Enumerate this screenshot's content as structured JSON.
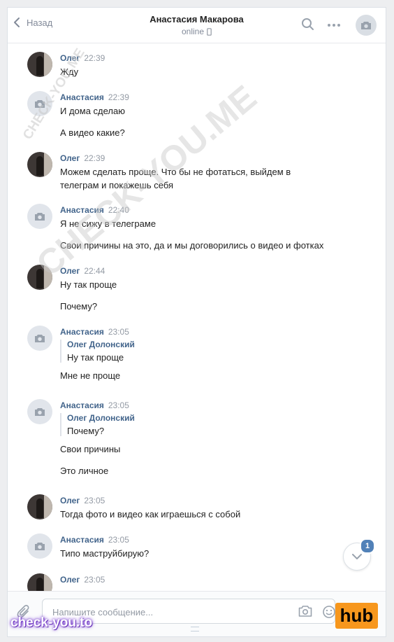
{
  "header": {
    "back_label": "Назад",
    "title": "Анастасия Макарова",
    "status": "online"
  },
  "messages": [
    {
      "sender": "Олег",
      "avatar": "oleg-photo",
      "time": "22:39",
      "lines": [
        "Жду"
      ]
    },
    {
      "sender": "Анастасия",
      "avatar": "camera-placeholder",
      "time": "22:39",
      "lines": [
        "И дома сделаю",
        "А видео какие?"
      ]
    },
    {
      "sender": "Олег",
      "avatar": "oleg-photo",
      "time": "22:39",
      "lines": [
        "Можем сделать проще. Что бы не фотаться, выйдем в",
        "телеграм и покажешь себя"
      ]
    },
    {
      "sender": "Анастасия",
      "avatar": "camera-placeholder",
      "time": "22:40",
      "lines": [
        "Я не сижу в телеграме",
        "Свои причины на это, да и мы договорились о видео и фотках"
      ]
    },
    {
      "sender": "Олег",
      "avatar": "oleg-photo",
      "time": "22:44",
      "lines": [
        "Ну так проще",
        "Почему?"
      ]
    },
    {
      "sender": "Анастасия",
      "avatar": "camera-placeholder",
      "time": "23:05",
      "quote": {
        "name": "Олег Долонский",
        "text": "Ну так проще"
      },
      "lines": [
        "Мне не проще"
      ]
    },
    {
      "sender": "Анастасия",
      "avatar": "camera-placeholder",
      "time": "23:05",
      "quote": {
        "name": "Олег Долонский",
        "text": "Почему?"
      },
      "lines": [
        "Свои причины",
        "Это личное"
      ]
    },
    {
      "sender": "Олег",
      "avatar": "oleg-photo",
      "time": "23:05",
      "lines": [
        "Тогда фото и видео как играешься с собой"
      ]
    },
    {
      "sender": "Анастасия",
      "avatar": "camera-placeholder",
      "time": "23:05",
      "lines": [
        "Типо маструйбирую?"
      ]
    },
    {
      "sender": "Олег",
      "avatar": "oleg-photo",
      "time": "23:05",
      "lines": []
    }
  ],
  "scroll_down": {
    "badge": "1"
  },
  "composer": {
    "placeholder": "Напишите сообщение..."
  },
  "watermarks": {
    "primary": "CHECK-YOU.ME",
    "secondary": "CHECK-YOU.ME",
    "footer_logo": "check-you.to",
    "hub_logo": "hub"
  },
  "colors": {
    "link": "#42648b",
    "accent": "#5181b8",
    "hub": "#f7971d"
  },
  "icons": [
    "chevron-left-icon",
    "phone-icon",
    "search-icon",
    "more-icon",
    "camera-icon",
    "chevron-down-icon",
    "paperclip-icon",
    "smile-icon",
    "camera-icon"
  ]
}
